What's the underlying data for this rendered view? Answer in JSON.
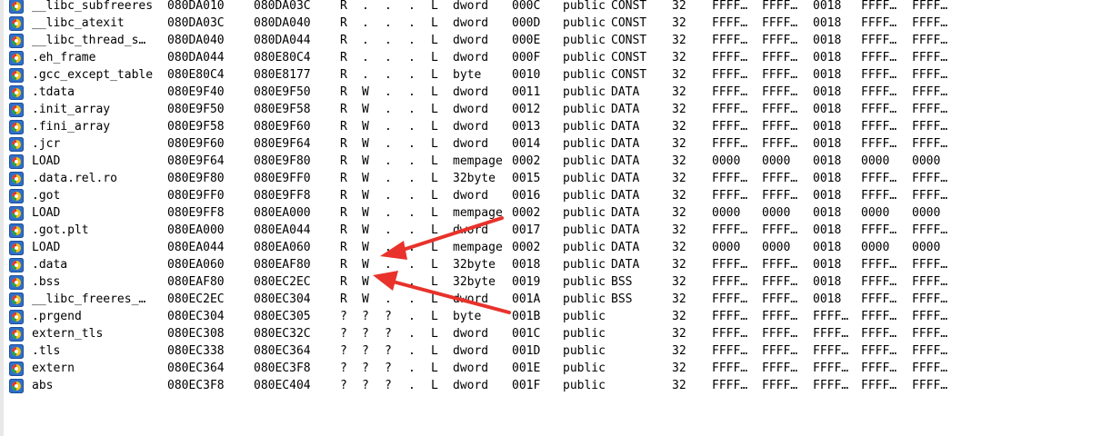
{
  "icon": "segment-icon",
  "arrow_color": "#e8322b",
  "rows": [
    {
      "name": "__libc_subfreeres",
      "start": "080DA010",
      "end": "080DA03C",
      "r": "R",
      "w": ".",
      "x": ".",
      "d": ".",
      "l": "L",
      "align": "dword",
      "base": "000C",
      "type": "public",
      "class": "CONST",
      "ad": "32",
      "t1": "FFFF…",
      "t2": "FFFF…",
      "t3": "0018",
      "t4": "FFFF…",
      "t5": "FFFF…"
    },
    {
      "name": "__libc_atexit",
      "start": "080DA03C",
      "end": "080DA040",
      "r": "R",
      "w": ".",
      "x": ".",
      "d": ".",
      "l": "L",
      "align": "dword",
      "base": "000D",
      "type": "public",
      "class": "CONST",
      "ad": "32",
      "t1": "FFFF…",
      "t2": "FFFF…",
      "t3": "0018",
      "t4": "FFFF…",
      "t5": "FFFF…"
    },
    {
      "name": "__libc_thread_s…",
      "start": "080DA040",
      "end": "080DA044",
      "r": "R",
      "w": ".",
      "x": ".",
      "d": ".",
      "l": "L",
      "align": "dword",
      "base": "000E",
      "type": "public",
      "class": "CONST",
      "ad": "32",
      "t1": "FFFF…",
      "t2": "FFFF…",
      "t3": "0018",
      "t4": "FFFF…",
      "t5": "FFFF…"
    },
    {
      "name": ".eh_frame",
      "start": "080DA044",
      "end": "080E80C4",
      "r": "R",
      "w": ".",
      "x": ".",
      "d": ".",
      "l": "L",
      "align": "dword",
      "base": "000F",
      "type": "public",
      "class": "CONST",
      "ad": "32",
      "t1": "FFFF…",
      "t2": "FFFF…",
      "t3": "0018",
      "t4": "FFFF…",
      "t5": "FFFF…"
    },
    {
      "name": ".gcc_except_table",
      "start": "080E80C4",
      "end": "080E8177",
      "r": "R",
      "w": ".",
      "x": ".",
      "d": ".",
      "l": "L",
      "align": "byte",
      "base": "0010",
      "type": "public",
      "class": "CONST",
      "ad": "32",
      "t1": "FFFF…",
      "t2": "FFFF…",
      "t3": "0018",
      "t4": "FFFF…",
      "t5": "FFFF…"
    },
    {
      "name": ".tdata",
      "start": "080E9F40",
      "end": "080E9F50",
      "r": "R",
      "w": "W",
      "x": ".",
      "d": ".",
      "l": "L",
      "align": "dword",
      "base": "0011",
      "type": "public",
      "class": "DATA",
      "ad": "32",
      "t1": "FFFF…",
      "t2": "FFFF…",
      "t3": "0018",
      "t4": "FFFF…",
      "t5": "FFFF…"
    },
    {
      "name": ".init_array",
      "start": "080E9F50",
      "end": "080E9F58",
      "r": "R",
      "w": "W",
      "x": ".",
      "d": ".",
      "l": "L",
      "align": "dword",
      "base": "0012",
      "type": "public",
      "class": "DATA",
      "ad": "32",
      "t1": "FFFF…",
      "t2": "FFFF…",
      "t3": "0018",
      "t4": "FFFF…",
      "t5": "FFFF…"
    },
    {
      "name": ".fini_array",
      "start": "080E9F58",
      "end": "080E9F60",
      "r": "R",
      "w": "W",
      "x": ".",
      "d": ".",
      "l": "L",
      "align": "dword",
      "base": "0013",
      "type": "public",
      "class": "DATA",
      "ad": "32",
      "t1": "FFFF…",
      "t2": "FFFF…",
      "t3": "0018",
      "t4": "FFFF…",
      "t5": "FFFF…"
    },
    {
      "name": ".jcr",
      "start": "080E9F60",
      "end": "080E9F64",
      "r": "R",
      "w": "W",
      "x": ".",
      "d": ".",
      "l": "L",
      "align": "dword",
      "base": "0014",
      "type": "public",
      "class": "DATA",
      "ad": "32",
      "t1": "FFFF…",
      "t2": "FFFF…",
      "t3": "0018",
      "t4": "FFFF…",
      "t5": "FFFF…"
    },
    {
      "name": "LOAD",
      "start": "080E9F64",
      "end": "080E9F80",
      "r": "R",
      "w": "W",
      "x": ".",
      "d": ".",
      "l": "L",
      "align": "mempage",
      "base": "0002",
      "type": "public",
      "class": "DATA",
      "ad": "32",
      "t1": "0000",
      "t2": "0000",
      "t3": "0018",
      "t4": "0000",
      "t5": "0000"
    },
    {
      "name": ".data.rel.ro",
      "start": "080E9F80",
      "end": "080E9FF0",
      "r": "R",
      "w": "W",
      "x": ".",
      "d": ".",
      "l": "L",
      "align": "32byte",
      "base": "0015",
      "type": "public",
      "class": "DATA",
      "ad": "32",
      "t1": "FFFF…",
      "t2": "FFFF…",
      "t3": "0018",
      "t4": "FFFF…",
      "t5": "FFFF…"
    },
    {
      "name": ".got",
      "start": "080E9FF0",
      "end": "080E9FF8",
      "r": "R",
      "w": "W",
      "x": ".",
      "d": ".",
      "l": "L",
      "align": "dword",
      "base": "0016",
      "type": "public",
      "class": "DATA",
      "ad": "32",
      "t1": "FFFF…",
      "t2": "FFFF…",
      "t3": "0018",
      "t4": "FFFF…",
      "t5": "FFFF…"
    },
    {
      "name": "LOAD",
      "start": "080E9FF8",
      "end": "080EA000",
      "r": "R",
      "w": "W",
      "x": ".",
      "d": ".",
      "l": "L",
      "align": "mempage",
      "base": "0002",
      "type": "public",
      "class": "DATA",
      "ad": "32",
      "t1": "0000",
      "t2": "0000",
      "t3": "0018",
      "t4": "0000",
      "t5": "0000"
    },
    {
      "name": ".got.plt",
      "start": "080EA000",
      "end": "080EA044",
      "r": "R",
      "w": "W",
      "x": ".",
      "d": ".",
      "l": "L",
      "align": "dword",
      "base": "0017",
      "type": "public",
      "class": "DATA",
      "ad": "32",
      "t1": "FFFF…",
      "t2": "FFFF…",
      "t3": "0018",
      "t4": "FFFF…",
      "t5": "FFFF…"
    },
    {
      "name": "LOAD",
      "start": "080EA044",
      "end": "080EA060",
      "r": "R",
      "w": "W",
      "x": ".",
      "d": ".",
      "l": "L",
      "align": "mempage",
      "base": "0002",
      "type": "public",
      "class": "DATA",
      "ad": "32",
      "t1": "0000",
      "t2": "0000",
      "t3": "0018",
      "t4": "0000",
      "t5": "0000"
    },
    {
      "name": ".data",
      "start": "080EA060",
      "end": "080EAF80",
      "r": "R",
      "w": "W",
      "x": ".",
      "d": ".",
      "l": "L",
      "align": "32byte",
      "base": "0018",
      "type": "public",
      "class": "DATA",
      "ad": "32",
      "t1": "FFFF…",
      "t2": "FFFF…",
      "t3": "0018",
      "t4": "FFFF…",
      "t5": "FFFF…"
    },
    {
      "name": ".bss",
      "start": "080EAF80",
      "end": "080EC2EC",
      "r": "R",
      "w": "W",
      "x": ".",
      "d": ".",
      "l": "L",
      "align": "32byte",
      "base": "0019",
      "type": "public",
      "class": "BSS",
      "ad": "32",
      "t1": "FFFF…",
      "t2": "FFFF…",
      "t3": "0018",
      "t4": "FFFF…",
      "t5": "FFFF…"
    },
    {
      "name": "__libc_freeres_…",
      "start": "080EC2EC",
      "end": "080EC304",
      "r": "R",
      "w": "W",
      "x": ".",
      "d": ".",
      "l": "L",
      "align": "dword",
      "base": "001A",
      "type": "public",
      "class": "BSS",
      "ad": "32",
      "t1": "FFFF…",
      "t2": "FFFF…",
      "t3": "0018",
      "t4": "FFFF…",
      "t5": "FFFF…"
    },
    {
      "name": ".prgend",
      "start": "080EC304",
      "end": "080EC305",
      "r": "?",
      "w": "?",
      "x": "?",
      "d": ".",
      "l": "L",
      "align": "byte",
      "base": "001B",
      "type": "public",
      "class": "",
      "ad": "32",
      "t1": "FFFF…",
      "t2": "FFFF…",
      "t3": "FFFF…",
      "t4": "FFFF…",
      "t5": "FFFF…"
    },
    {
      "name": "extern_tls",
      "start": "080EC308",
      "end": "080EC32C",
      "r": "?",
      "w": "?",
      "x": "?",
      "d": ".",
      "l": "L",
      "align": "dword",
      "base": "001C",
      "type": "public",
      "class": "",
      "ad": "32",
      "t1": "FFFF…",
      "t2": "FFFF…",
      "t3": "FFFF…",
      "t4": "FFFF…",
      "t5": "FFFF…"
    },
    {
      "name": ".tls",
      "start": "080EC338",
      "end": "080EC364",
      "r": "?",
      "w": "?",
      "x": "?",
      "d": ".",
      "l": "L",
      "align": "dword",
      "base": "001D",
      "type": "public",
      "class": "",
      "ad": "32",
      "t1": "FFFF…",
      "t2": "FFFF…",
      "t3": "FFFF…",
      "t4": "FFFF…",
      "t5": "FFFF…"
    },
    {
      "name": "extern",
      "start": "080EC364",
      "end": "080EC3F8",
      "r": "?",
      "w": "?",
      "x": "?",
      "d": ".",
      "l": "L",
      "align": "dword",
      "base": "001E",
      "type": "public",
      "class": "",
      "ad": "32",
      "t1": "FFFF…",
      "t2": "FFFF…",
      "t3": "FFFF…",
      "t4": "FFFF…",
      "t5": "FFFF…"
    },
    {
      "name": "abs",
      "start": "080EC3F8",
      "end": "080EC404",
      "r": "?",
      "w": "?",
      "x": "?",
      "d": ".",
      "l": "L",
      "align": "dword",
      "base": "001F",
      "type": "public",
      "class": "",
      "ad": "32",
      "t1": "FFFF…",
      "t2": "FFFF…",
      "t3": "FFFF…",
      "t4": "FFFF…",
      "t5": "FFFF…"
    }
  ]
}
